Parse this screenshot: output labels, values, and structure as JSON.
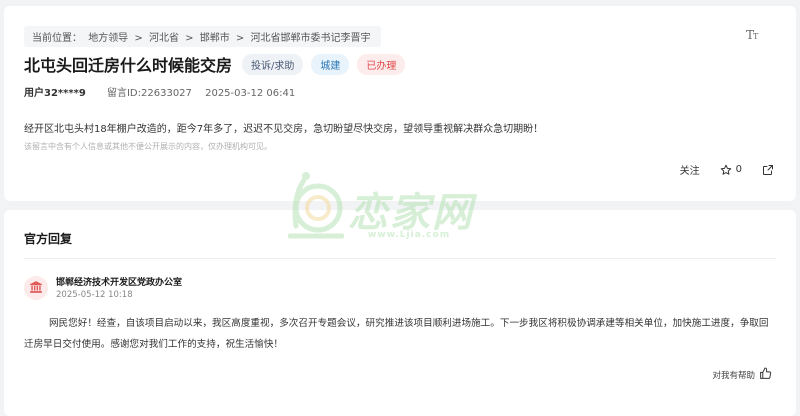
{
  "breadcrumb": {
    "prefix": "当前位置：",
    "items": [
      "地方领导",
      "河北省",
      "邯郸市",
      "河北省邯郸市委书记李晋宇"
    ],
    "separator": ">"
  },
  "post": {
    "title": "北屯头回迁房什么时候能交房",
    "tags": {
      "type": "投诉/求助",
      "category": "城建",
      "status": "已办理"
    },
    "user": "用户32****9",
    "message_id": "留言ID:22633027",
    "time": "2025-03-12 06:41",
    "content": "经开区北屯头村18年棚户改造的，距今7年多了，迟迟不见交房，急切盼望尽快交房，望领导重视解决群众急切期盼！",
    "hint": "该留言中含有个人信息或其他不便公开展示的内容，仅办理机构可见。"
  },
  "actions": {
    "follow_label": "关注",
    "favorite_count": "0"
  },
  "reply_section": {
    "title": "官方回复",
    "org_name": "邯郸经济技术开发区党政办公室",
    "date": "2025-05-12 10:18",
    "text": "网民您好！经查，自该项目启动以来，我区高度重视，多次召开专题会议，研究推进该项目顺利进场施工。下一步我区将积极协调承建等相关单位，加快施工进度，争取回迁房早日交付使用。感谢您对我们工作的支持，祝生活愉快！",
    "helpful_label": "对我有帮助"
  },
  "watermark": {
    "brand": "恋家网",
    "url": "www.Ljia.com"
  },
  "colors": {
    "status_red": "#e0484a",
    "tag_blue": "#2b78b8",
    "background": "#f2f3f5"
  },
  "icons": [
    "font-size-icon",
    "star-icon",
    "share-icon",
    "government-building-icon",
    "thumbs-up-icon"
  ]
}
